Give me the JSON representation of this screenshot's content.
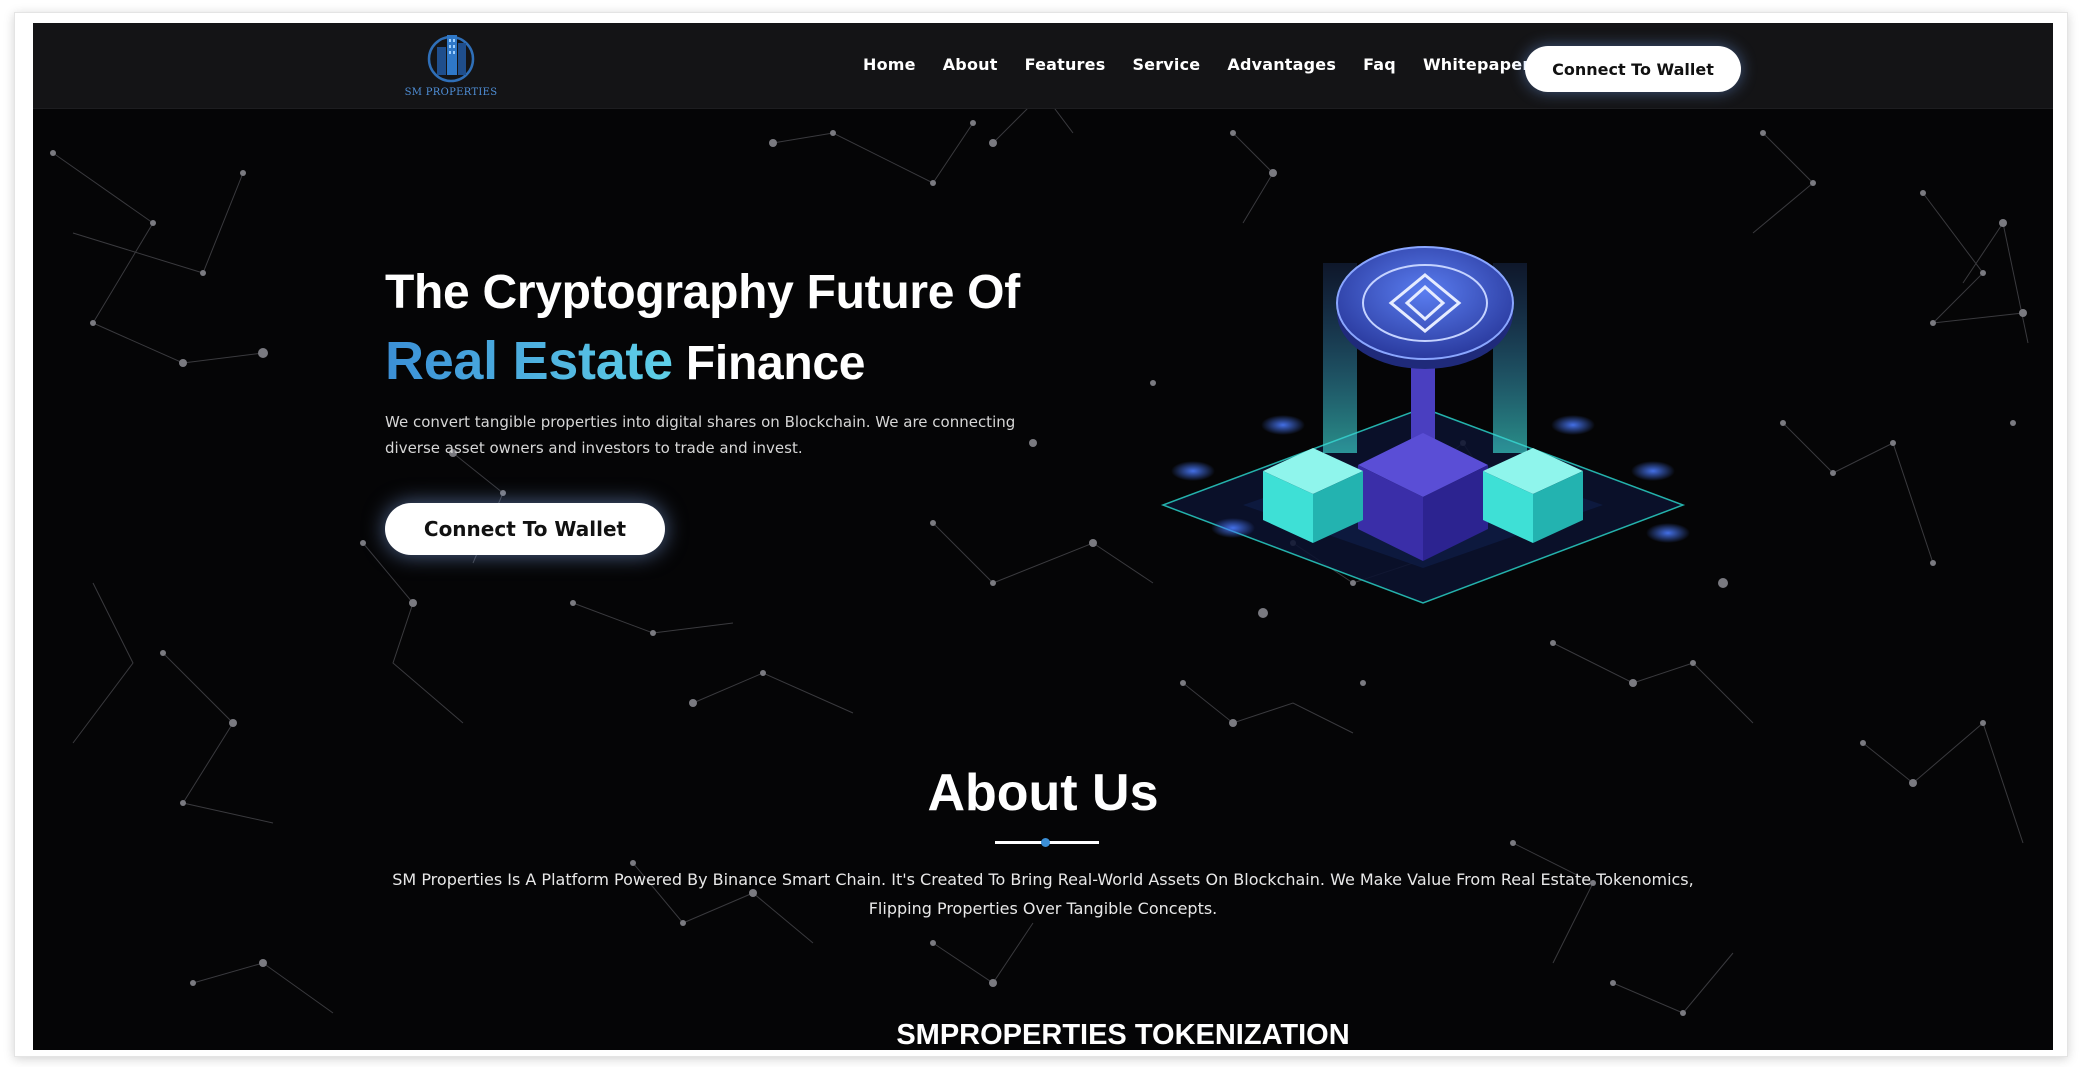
{
  "brand": {
    "name": "SM PROPERTIES",
    "icon": "buildings-logo-icon"
  },
  "nav": {
    "items": [
      "Home",
      "About",
      "Features",
      "Service",
      "Advantages",
      "Faq",
      "Whitepaper"
    ],
    "cta_label": "Connect To Wallet"
  },
  "hero": {
    "title_line1": "The Cryptography Future Of",
    "title_highlight": "Real Estate",
    "title_end": "Finance",
    "description": "We convert tangible properties into digital shares on Blockchain. We are connecting diverse asset owners and investors to trade and invest.",
    "cta_label": "Connect To Wallet",
    "illustration": "blockchain-isometric-illustration"
  },
  "about": {
    "title": "About Us",
    "text": "SM Properties Is A Platform Powered By Binance Smart Chain. It's Created To Bring Real-World Assets On Blockchain. We Make Value From Real Estate Tokenomics, Flipping Properties Over Tangible Concepts."
  },
  "tokenization": {
    "title": "SMPROPERTIES TOKENIZATION"
  },
  "colors": {
    "background": "#050506",
    "nav": "#141416",
    "accent_start": "#3b8fd6",
    "accent_end": "#5fd0e8",
    "cube": "#3ee0d6",
    "base": "#4338a8"
  }
}
